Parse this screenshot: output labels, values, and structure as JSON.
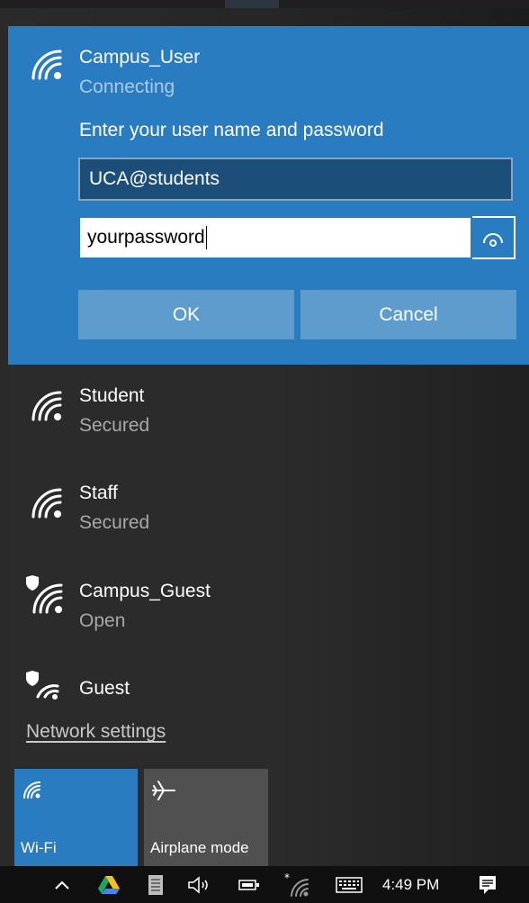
{
  "connecting": {
    "name": "Campus_User",
    "status": "Connecting",
    "prompt": "Enter your user name and password",
    "username_value": "UCA@students",
    "password_value": "yourpassword",
    "ok_label": "OK",
    "cancel_label": "Cancel"
  },
  "networks": [
    {
      "name": "Student",
      "status": "Secured",
      "icon": "wifi-icon"
    },
    {
      "name": "Staff",
      "status": "Secured",
      "icon": "wifi-icon"
    },
    {
      "name": "Campus_Guest",
      "status": "Open",
      "icon": "wifi-shield-icon"
    },
    {
      "name": "Guest",
      "status": "",
      "icon": "wifi-shield-icon"
    }
  ],
  "network_settings_label": "Network settings",
  "quick_actions": [
    {
      "label": "Wi-Fi",
      "active": true,
      "icon": "wifi-icon"
    },
    {
      "label": "Airplane mode",
      "active": false,
      "icon": "airplane-icon"
    }
  ],
  "taskbar": {
    "clock": "4:49 PM",
    "icons": [
      "chevron-up-icon",
      "google-drive-icon",
      "document-icon",
      "speaker-icon",
      "battery-icon",
      "wifi-icon",
      "keyboard-icon",
      "notification-icon"
    ]
  },
  "colors": {
    "accent": "#2a7cc0",
    "button": "#5d9ccd",
    "flyout_bg": "#2b2b2b",
    "taskbar_bg": "#101010"
  }
}
